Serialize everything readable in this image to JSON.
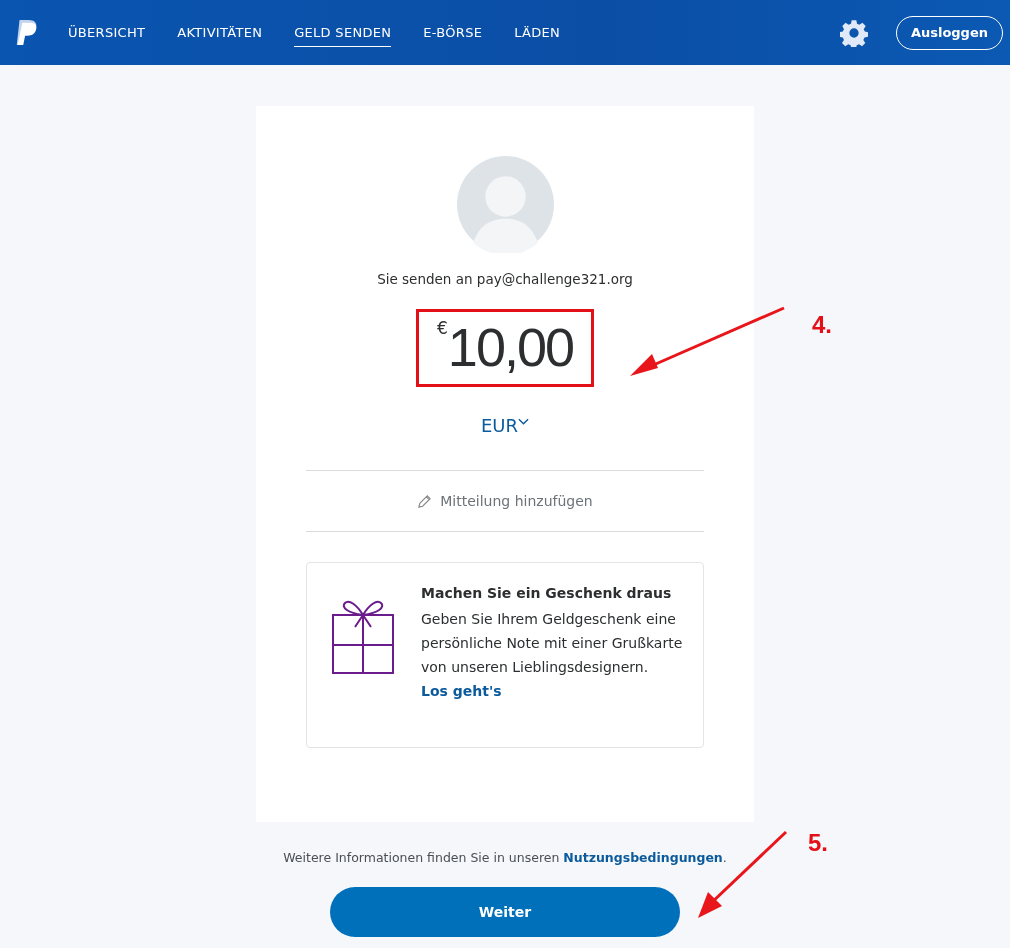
{
  "nav": {
    "tabs": [
      {
        "label": "ÜBERSICHT",
        "selected": false
      },
      {
        "label": "AKTIVITÄTEN",
        "selected": false
      },
      {
        "label": "GELD SENDEN",
        "selected": true
      },
      {
        "label": "E-BÖRSE",
        "selected": false
      },
      {
        "label": "LÄDEN",
        "selected": false
      }
    ],
    "logout": "Ausloggen"
  },
  "recipient": "Sie senden an pay@challenge321.org",
  "amount": {
    "symbol": "€",
    "value": "10,00",
    "currency": "EUR"
  },
  "message": "Mitteilung hinzufügen",
  "gift": {
    "title": "Machen Sie ein Geschenk draus",
    "text": "Geben Sie Ihrem Geldgeschenk eine persönliche Note mit einer Grußkarte von unseren Lieblingsdesignern.",
    "link": "Los geht's"
  },
  "terms": {
    "before": "Weitere Informationen finden Sie in unseren ",
    "link": "Nutzungsbedingungen",
    "after": "."
  },
  "continue": "Weiter",
  "annotations": [
    {
      "label": "4."
    },
    {
      "label": "5."
    }
  ]
}
